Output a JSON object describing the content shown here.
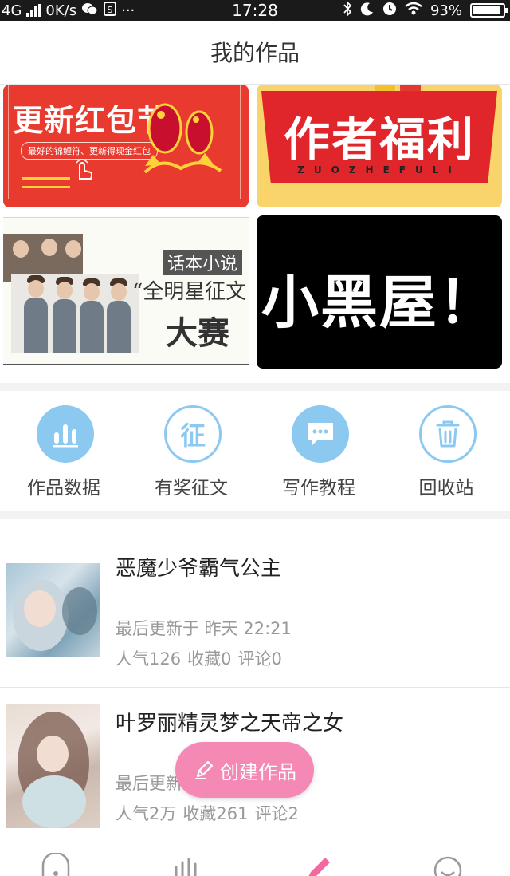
{
  "status_bar": {
    "network": "4G",
    "speed": "0K/s",
    "time": "17:28",
    "battery": "93%",
    "battery_level": 0.93
  },
  "header": {
    "title": "我的作品"
  },
  "banners": [
    {
      "title": "更新红包节",
      "subtitle": "最好的锦鲤符、更新得现金红包",
      "color": "#e83a2f"
    },
    {
      "title": "作者福利",
      "subtitle": "ZUOZHEFULI",
      "color": "#e0262a"
    },
    {
      "tag": "话本小说",
      "quote": "“全明星征文",
      "title": "大赛"
    },
    {
      "title": "小黑屋！",
      "color": "#000000"
    }
  ],
  "actions": [
    {
      "label": "作品数据",
      "icon": "bar-chart-icon"
    },
    {
      "label": "有奖征文",
      "icon": "zheng-badge-icon",
      "glyph": "征"
    },
    {
      "label": "写作教程",
      "icon": "chat-bubble-icon"
    },
    {
      "label": "回收站",
      "icon": "trash-icon"
    }
  ],
  "works": [
    {
      "title": "恶魔少爷霸气公主",
      "updated": "最后更新于 昨天 22:21",
      "popularity": "人气126",
      "favorites": "收藏0",
      "comments": "评论0"
    },
    {
      "title": "叶罗丽精灵梦之天帝之女",
      "updated": "最后更新",
      "popularity": "人气2万",
      "favorites": "收藏261",
      "comments": "评论2"
    }
  ],
  "fab": {
    "label": "创建作品"
  },
  "tabbar": {
    "active_index": 2,
    "icons": [
      "home-icon",
      "stats-icon",
      "write-icon",
      "profile-icon"
    ]
  },
  "colors": {
    "accent_blue": "#8cc9f1",
    "fab_pink": "#f589b5",
    "tab_active": "#f06a9f"
  }
}
